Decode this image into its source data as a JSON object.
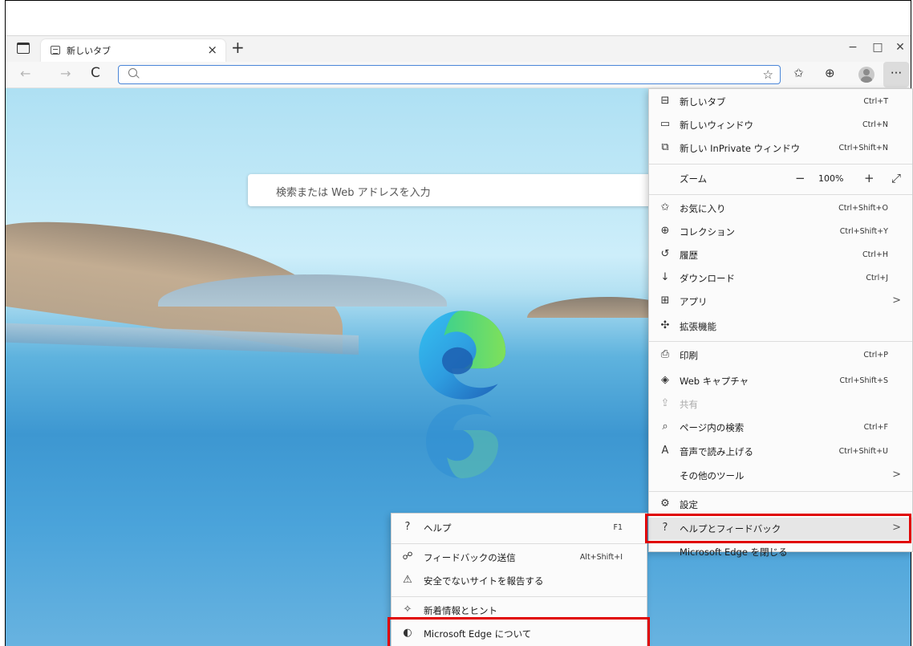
{
  "browser": {
    "tab": {
      "title": "新しいタブ",
      "close": "×"
    },
    "new_tab": "+",
    "window_controls": {
      "minimize": "−",
      "maximize": "□",
      "close": "✕"
    },
    "nav": {
      "back": "←",
      "forward": "→",
      "refresh": "C"
    },
    "address_bar": {
      "value": ""
    },
    "more": "···"
  },
  "page": {
    "search_placeholder": "検索または Web アドレスを入力"
  },
  "menu": {
    "new_tab": {
      "label": "新しいタブ",
      "shortcut": "Ctrl+T"
    },
    "new_window": {
      "label": "新しいウィンドウ",
      "shortcut": "Ctrl+N"
    },
    "new_inprivate": {
      "label": "新しい InPrivate ウィンドウ",
      "shortcut": "Ctrl+Shift+N"
    },
    "zoom": {
      "label": "ズーム",
      "minus": "−",
      "value": "100%",
      "plus": "+",
      "fullscreen": "⤢"
    },
    "favorites": {
      "label": "お気に入り",
      "shortcut": "Ctrl+Shift+O"
    },
    "collections": {
      "label": "コレクション",
      "shortcut": "Ctrl+Shift+Y"
    },
    "history": {
      "label": "履歴",
      "shortcut": "Ctrl+H"
    },
    "downloads": {
      "label": "ダウンロード",
      "shortcut": "Ctrl+J"
    },
    "apps": {
      "label": "アプリ",
      "arrow": ">"
    },
    "extensions": {
      "label": "拡張機能"
    },
    "print": {
      "label": "印刷",
      "shortcut": "Ctrl+P"
    },
    "web_capture": {
      "label": "Web キャプチャ",
      "shortcut": "Ctrl+Shift+S"
    },
    "share": {
      "label": "共有"
    },
    "find": {
      "label": "ページ内の検索",
      "shortcut": "Ctrl+F"
    },
    "read_aloud": {
      "label": "音声で読み上げる",
      "shortcut": "Ctrl+Shift+U"
    },
    "more_tools": {
      "label": "その他のツール",
      "arrow": ">"
    },
    "settings": {
      "label": "設定"
    },
    "help_feedback": {
      "label": "ヘルプとフィードバック",
      "arrow": ">"
    },
    "close_edge": {
      "label": "Microsoft Edge を閉じる"
    }
  },
  "submenu": {
    "help": {
      "label": "ヘルプ",
      "shortcut": "F1"
    },
    "send_feedback": {
      "label": "フィードバックの送信",
      "shortcut": "Alt+Shift+I"
    },
    "report_unsafe": {
      "label": "安全でないサイトを報告する"
    },
    "whats_new": {
      "label": "新着情報とヒント"
    },
    "about": {
      "label": "Microsoft Edge について"
    }
  },
  "colors": {
    "highlight": "#e00000",
    "accent": "#4a86d8"
  }
}
